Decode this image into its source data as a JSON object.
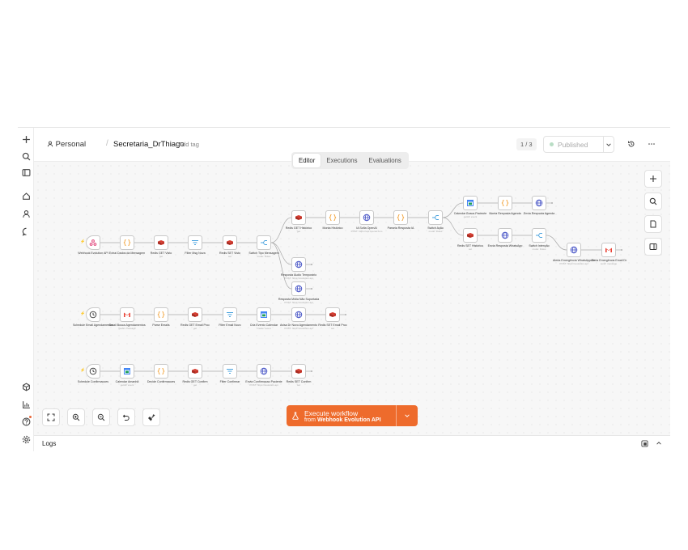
{
  "header": {
    "project": "Personal",
    "workflow_name": "Secretaria_DrThiago",
    "add_tag": "+ Add tag",
    "counter": "1 / 3",
    "publish_label": "Published"
  },
  "tabs": [
    {
      "label": "Editor",
      "active": true
    },
    {
      "label": "Executions",
      "active": false
    },
    {
      "label": "Evaluations",
      "active": false
    }
  ],
  "execute": {
    "label": "Execute workflow",
    "from_prefix": "from",
    "from_node": "Webhook Evolution API"
  },
  "logs": {
    "label": "Logs"
  },
  "colors": {
    "accent": "#ee6b2c",
    "redis": "#d63a2e",
    "code": "#f2a33a",
    "http": "#4a57c7",
    "filter": "#4aa3df",
    "switch": "#4aa3df",
    "calendar": "#1e9e5a",
    "gmail": "#e94235",
    "webhook": "#e0457b"
  },
  "nodes": [
    {
      "id": "n1",
      "label": "Webhook Evolution API",
      "sub": "",
      "icon": "webhook-icon"
    },
    {
      "id": "n2",
      "label": "Extrai Dados da Mensagem",
      "sub": "",
      "icon": "code-icon"
    },
    {
      "id": "n3",
      "label": "Redis GET Visto",
      "sub": "get",
      "icon": "redis-icon"
    },
    {
      "id": "n4",
      "label": "Filter Msg Nova",
      "sub": "",
      "icon": "filter-icon"
    },
    {
      "id": "n5",
      "label": "Redis SET Visto",
      "sub": "set",
      "icon": "redis-icon"
    },
    {
      "id": "n6",
      "label": "Switch Tipo Mensagem",
      "sub": "mode: Rules",
      "icon": "switch-icon"
    },
    {
      "id": "n7",
      "label": "Redis GET Histórico",
      "sub": "get",
      "icon": "redis-icon"
    },
    {
      "id": "n8",
      "label": "Monta Histórico",
      "sub": "",
      "icon": "code-icon"
    },
    {
      "id": "n9",
      "label": "IA Sofia OpenAI",
      "sub": "POST: https://api.openai.com",
      "icon": "http-icon"
    },
    {
      "id": "n10",
      "label": "Parseia Resposta IA",
      "sub": "",
      "icon": "code-icon"
    },
    {
      "id": "n11",
      "label": "Switch Ação",
      "sub": "mode: Rules",
      "icon": "switch-icon"
    },
    {
      "id": "n12",
      "label": "Calendar Busca Paciente",
      "sub": "getAll: event",
      "icon": "calendar-icon"
    },
    {
      "id": "n13",
      "label": "Monta Resposta Agenda",
      "sub": "",
      "icon": "code-icon"
    },
    {
      "id": "n14",
      "label": "Envia Resposta Agenda",
      "sub": "",
      "icon": "http-icon"
    },
    {
      "id": "n15",
      "label": "Redis SET Histórico",
      "sub": "set",
      "icon": "redis-icon"
    },
    {
      "id": "n16",
      "label": "Envia Resposta WhatsApp",
      "sub": "",
      "icon": "http-icon"
    },
    {
      "id": "n17",
      "label": "Switch Intenção",
      "sub": "mode: Rules",
      "icon": "switch-icon"
    },
    {
      "id": "n18",
      "label": "Alerta Emergência WhatsApp Dr",
      "sub": "POST: https://evolution.api",
      "icon": "http-icon"
    },
    {
      "id": "n19",
      "label": "Alerta Emergência Email Dr",
      "sub": "send: message",
      "icon": "gmail-icon"
    },
    {
      "id": "n20",
      "label": "Resposta Áudio Temporário",
      "sub": "POST: https://evolution.api",
      "icon": "http-icon"
    },
    {
      "id": "n21",
      "label": "Resposta Mídia Não Suportada",
      "sub": "POST: https://evolution.api",
      "icon": "http-icon"
    },
    {
      "id": "n22",
      "label": "Schedule Email Agendamentos",
      "sub": "",
      "icon": "clock-icon"
    },
    {
      "id": "n23",
      "label": "Gmail Busca Agendamentos",
      "sub": "getAll: message",
      "icon": "gmail-icon"
    },
    {
      "id": "n24",
      "label": "Parse Emails",
      "sub": "",
      "icon": "code-icon"
    },
    {
      "id": "n25",
      "label": "Redis GET Email Proc",
      "sub": "get",
      "icon": "redis-icon"
    },
    {
      "id": "n26",
      "label": "Filter Email Novo",
      "sub": "",
      "icon": "filter-icon"
    },
    {
      "id": "n27",
      "label": "Cria Evento Calendar",
      "sub": "create: event",
      "icon": "calendar-icon"
    },
    {
      "id": "n28",
      "label": "Avisa Dr Novo Agendamento",
      "sub": "POST: https://evolution.api",
      "icon": "http-icon"
    },
    {
      "id": "n29",
      "label": "Redis SET Email Proc",
      "sub": "set",
      "icon": "redis-icon"
    },
    {
      "id": "n30",
      "label": "Schedule Confirmacoes",
      "sub": "",
      "icon": "clock-icon"
    },
    {
      "id": "n31",
      "label": "Calendar Amanhã",
      "sub": "getAll: event",
      "icon": "calendar-icon"
    },
    {
      "id": "n32",
      "label": "Decide Confirmacoes",
      "sub": "",
      "icon": "code-icon"
    },
    {
      "id": "n33",
      "label": "Redis GET Confirm",
      "sub": "get",
      "icon": "redis-icon"
    },
    {
      "id": "n34",
      "label": "Filter Confirmar",
      "sub": "",
      "icon": "filter-icon"
    },
    {
      "id": "n35",
      "label": "Envia Confirmacao Paciente",
      "sub": "POST: https://evolution.api",
      "icon": "http-icon"
    },
    {
      "id": "n36",
      "label": "Redis SET Confirm",
      "sub": "set",
      "icon": "redis-icon"
    }
  ]
}
